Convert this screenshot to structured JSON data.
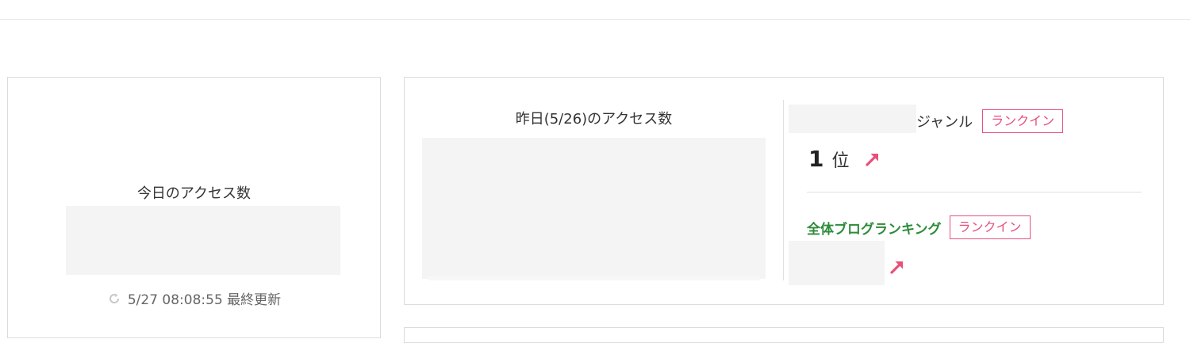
{
  "today": {
    "title": "今日のアクセス数",
    "last_updated": "5/27 08:08:55 最終更新",
    "refresh_icon": "refresh-icon"
  },
  "yesterday": {
    "title": "昨日(5/26)のアクセス数"
  },
  "genre_ranking": {
    "label": "ジャンル",
    "badge": "ランクイン",
    "rank_number": "1",
    "rank_unit": "位",
    "trend_icon": "up-right-arrow-icon"
  },
  "overall_ranking": {
    "label": "全体ブログランキング",
    "badge": "ランクイン",
    "trend_icon": "up-right-arrow-icon"
  },
  "colors": {
    "badge_accent": "#e8507a",
    "overall_label": "#2e8b3a",
    "placeholder": "#f4f4f4"
  }
}
